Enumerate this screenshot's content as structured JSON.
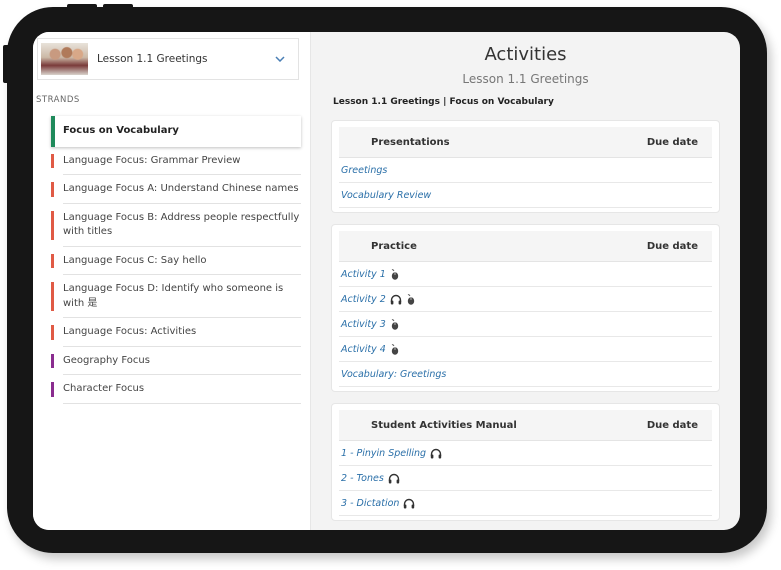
{
  "sidebar": {
    "lesson_select": {
      "label": "Lesson 1.1 Greetings",
      "thumbnail": "students-photo"
    },
    "strands_heading": "STRANDS",
    "strands": [
      {
        "label": "Focus on Vocabulary",
        "color": "#1f8a5b",
        "active": true
      },
      {
        "label": "Language Focus: Grammar Preview",
        "color": "#e05a45"
      },
      {
        "label": "Language Focus A: Understand Chinese names",
        "color": "#e05a45"
      },
      {
        "label": "Language Focus B: Address people respectfully with titles",
        "color": "#e05a45"
      },
      {
        "label": "Language Focus C: Say hello",
        "color": "#e05a45"
      },
      {
        "label": "Language Focus D: Identify who someone is with 是",
        "color": "#e05a45"
      },
      {
        "label": "Language Focus: Activities",
        "color": "#e05a45"
      },
      {
        "label": "Geography Focus",
        "color": "#8a2c8f"
      },
      {
        "label": "Character Focus",
        "color": "#8a2c8f"
      }
    ]
  },
  "main": {
    "title": "Activities",
    "subtitle": "Lesson 1.1 Greetings",
    "breadcrumb": "Lesson 1.1 Greetings | Focus on Vocabulary",
    "sections": [
      {
        "title": "Presentations",
        "due_header": "Due date",
        "items": [
          {
            "label": "Greetings",
            "icons": []
          },
          {
            "label": "Vocabulary Review",
            "icons": []
          }
        ]
      },
      {
        "title": "Practice",
        "due_header": "Due date",
        "items": [
          {
            "label": "Activity 1",
            "icons": [
              "mouse-icon"
            ]
          },
          {
            "label": "Activity 2",
            "icons": [
              "headphones-icon",
              "mouse-icon"
            ]
          },
          {
            "label": "Activity 3",
            "icons": [
              "mouse-icon"
            ]
          },
          {
            "label": "Activity 4",
            "icons": [
              "mouse-icon"
            ]
          },
          {
            "label": "Vocabulary: Greetings",
            "icons": []
          }
        ]
      },
      {
        "title": "Student Activities Manual",
        "due_header": "Due date",
        "items": [
          {
            "label": "1 - Pinyin Spelling",
            "icons": [
              "headphones-icon"
            ]
          },
          {
            "label": "2 - Tones",
            "icons": [
              "headphones-icon"
            ]
          },
          {
            "label": "3 - Dictation",
            "icons": [
              "headphones-icon"
            ]
          }
        ]
      }
    ]
  },
  "colors": {
    "link": "#2a6fa8",
    "vocab_accent": "#1f8a5b",
    "language_accent": "#e05a45",
    "culture_accent": "#8a2c8f"
  }
}
